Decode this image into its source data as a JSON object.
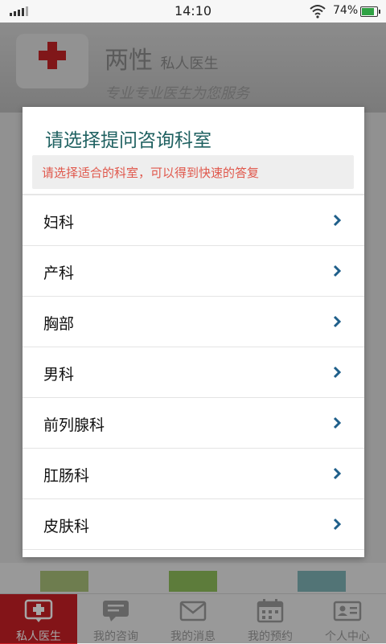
{
  "status_bar": {
    "time": "14:10",
    "battery_percent": "74%",
    "battery_level": 0.74
  },
  "background_app": {
    "brand_title": "两性",
    "brand_subtitle": "私人医生",
    "slogan": "专业专业医生为您服务"
  },
  "dialog": {
    "title": "请选择提问咨询科室",
    "hint": "请选择适合的科室，可以得到快速的答复",
    "departments": [
      {
        "label": "妇科"
      },
      {
        "label": "产科"
      },
      {
        "label": "胸部"
      },
      {
        "label": "男科"
      },
      {
        "label": "前列腺科"
      },
      {
        "label": "肛肠科"
      },
      {
        "label": "皮肤科"
      }
    ]
  },
  "tabbar": {
    "tabs": [
      {
        "label": "私人医生",
        "icon": "medical-cross-icon",
        "active": true
      },
      {
        "label": "我的咨询",
        "icon": "chat-icon",
        "active": false
      },
      {
        "label": "我的消息",
        "icon": "envelope-icon",
        "active": false
      },
      {
        "label": "我的预约",
        "icon": "calendar-icon",
        "active": false
      },
      {
        "label": "个人中心",
        "icon": "id-card-icon",
        "active": false
      }
    ]
  },
  "colors": {
    "accent_red": "#c91f25",
    "title_teal": "#1f6161",
    "hint_red": "#e0584c",
    "chevron_blue": "#1f5f8a"
  }
}
